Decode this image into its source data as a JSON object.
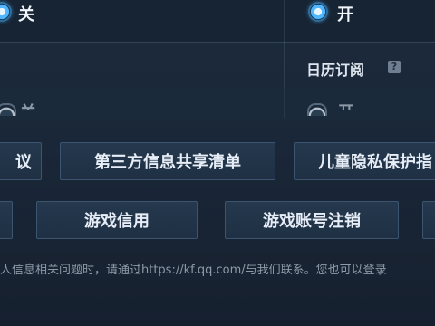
{
  "settings": {
    "row1": {
      "left_option": "关",
      "right_option": "开"
    },
    "calendar": {
      "title": "日历订阅",
      "help_icon": "?"
    },
    "row2": {
      "left_option": "关",
      "right_option": "开"
    }
  },
  "buttons": {
    "row1": [
      "议",
      "第三方信息共享清单",
      "儿童隐私保护指"
    ],
    "row2": [
      "游戏信用",
      "游戏账号注销"
    ]
  },
  "footer": {
    "text": "人信息相关问题时，请通过https://kf.qq.com/与我们联系。您也可以登录"
  }
}
